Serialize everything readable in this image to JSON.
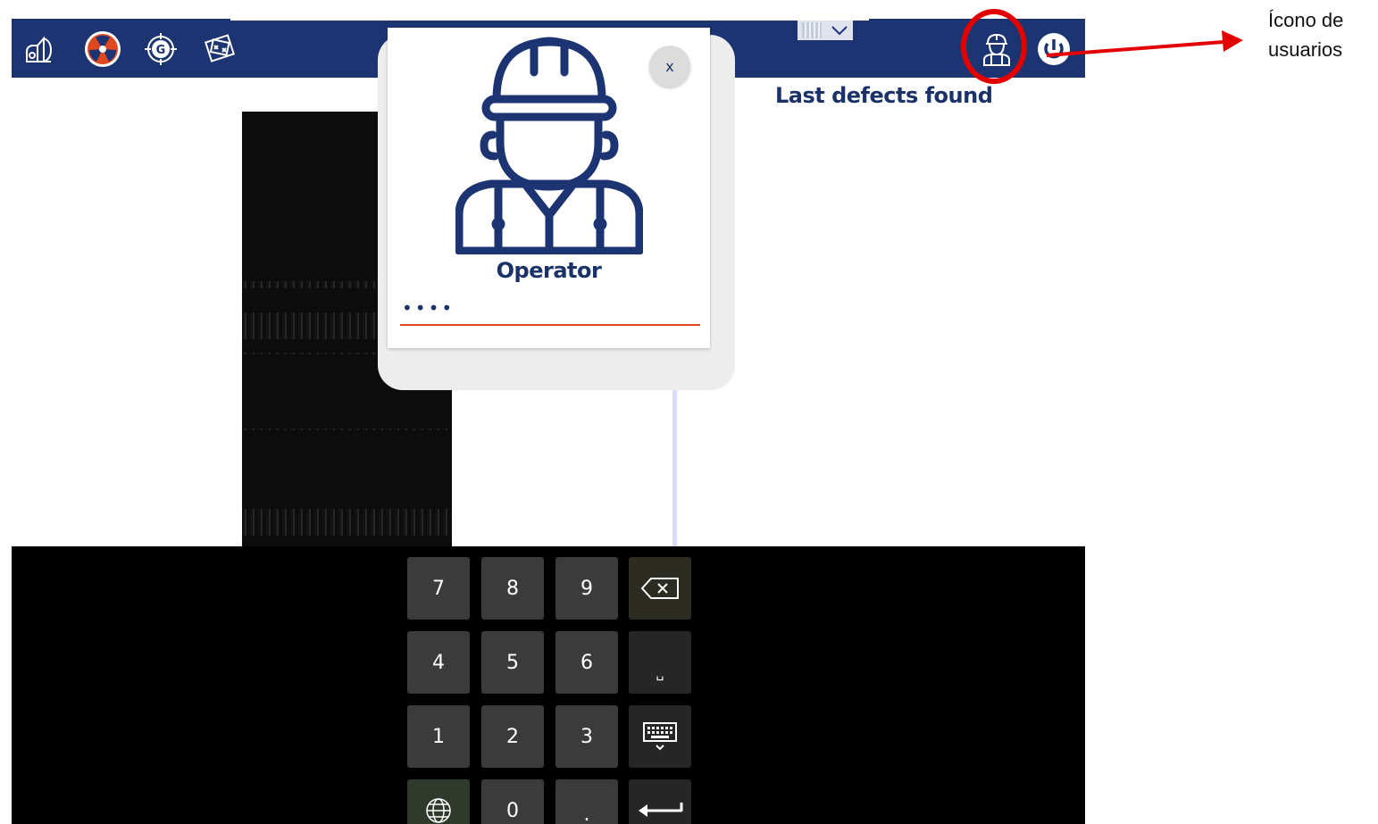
{
  "toolbar": {
    "icons": [
      {
        "name": "sensor-icon",
        "color": "#ffffff"
      },
      {
        "name": "radiation-icon",
        "color": "#e0481f"
      },
      {
        "name": "target-g-icon",
        "label": "G",
        "color": "#ffffff"
      },
      {
        "name": "ruler-icon",
        "color": "#ffffff"
      },
      {
        "name": "operator-icon",
        "color": "#ffffff"
      },
      {
        "name": "power-icon",
        "color": "#ffffff"
      }
    ],
    "background": "#1d3472"
  },
  "main": {
    "last_defects_title": "Last defects found"
  },
  "login_dialog": {
    "close_label": "x",
    "role_label": "Operator",
    "password_value": "••••",
    "accent_color": "#e0481f"
  },
  "keypad": {
    "keys": [
      "7",
      "8",
      "9",
      "4",
      "5",
      "6",
      "1",
      "2",
      "3",
      "0",
      "."
    ],
    "space_label": "␣"
  },
  "annotation": {
    "line1": "Ícono de",
    "line2": "usuarios",
    "color": "#e30000"
  }
}
